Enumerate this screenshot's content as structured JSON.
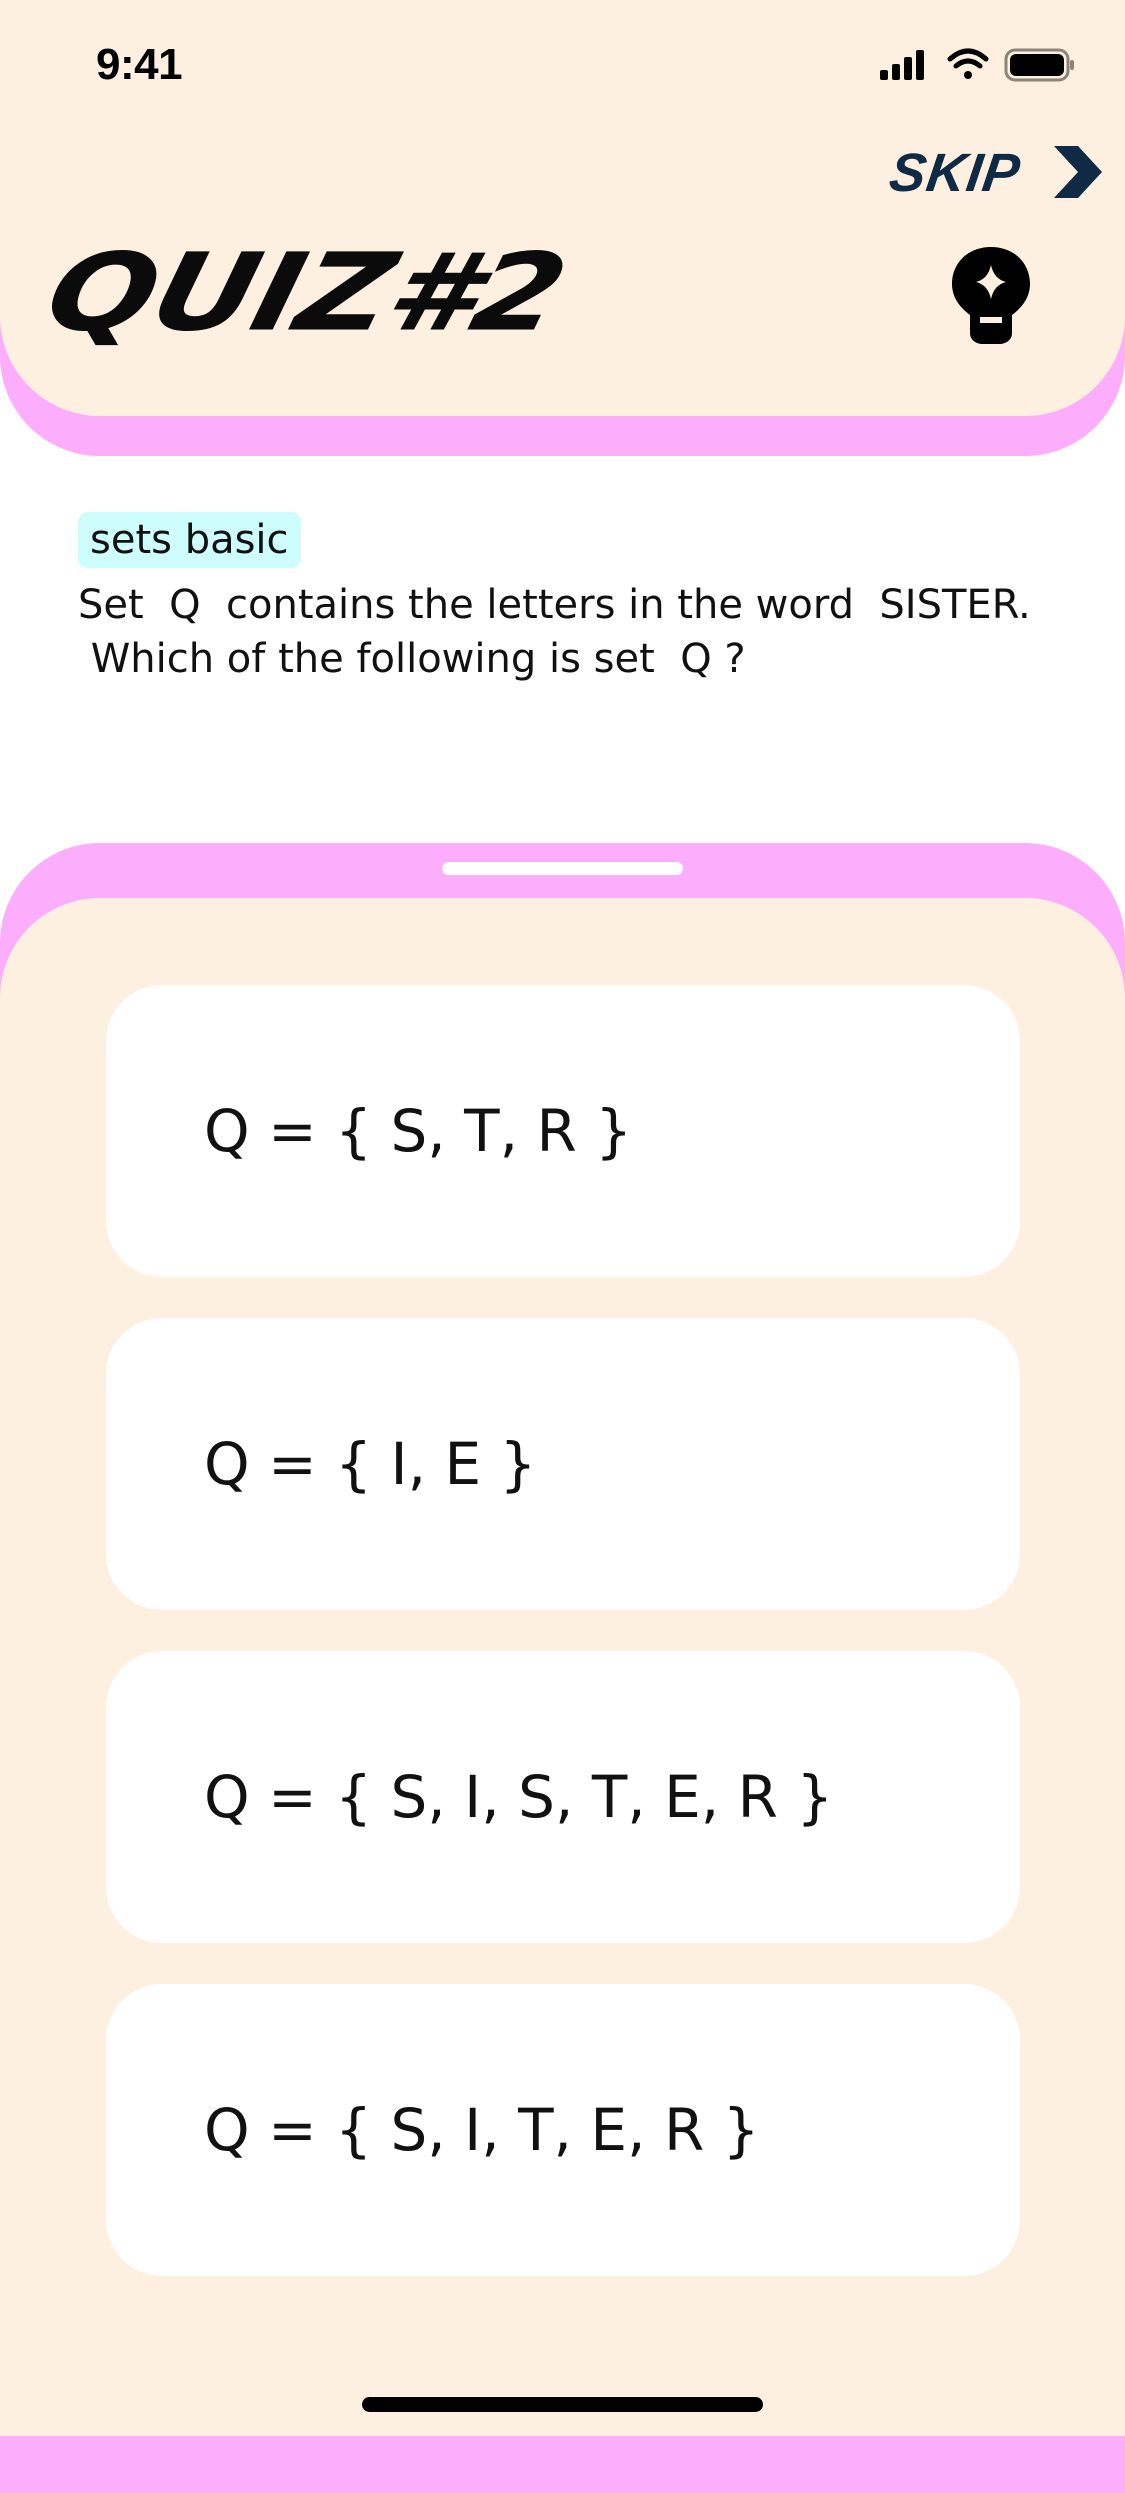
{
  "status_bar": {
    "time": "9:41",
    "icons": [
      "cellular-signal-icon",
      "wifi-icon",
      "battery-icon"
    ]
  },
  "header": {
    "skip_label": "SKIP",
    "title": "QUIZ#2",
    "hint_icon": "lightbulb-sparkle-icon"
  },
  "question": {
    "tag": "sets basic",
    "text": "Set  Q  contains the letters in the word  SISTER.\n Which of the following is set  Q ?"
  },
  "options": [
    {
      "label": "Q = { S, T, R }"
    },
    {
      "label": "Q = { I, E }"
    },
    {
      "label": "Q = { S, I, S, T, E, R }"
    },
    {
      "label": "Q = { S, I, T, E, R }"
    }
  ],
  "colors": {
    "background": "#fdf0e0",
    "accent_pink": "#fcaefc",
    "tag_cyan": "#cdfdfd",
    "skip_navy": "#0f2a44",
    "card": "#ffffff"
  }
}
